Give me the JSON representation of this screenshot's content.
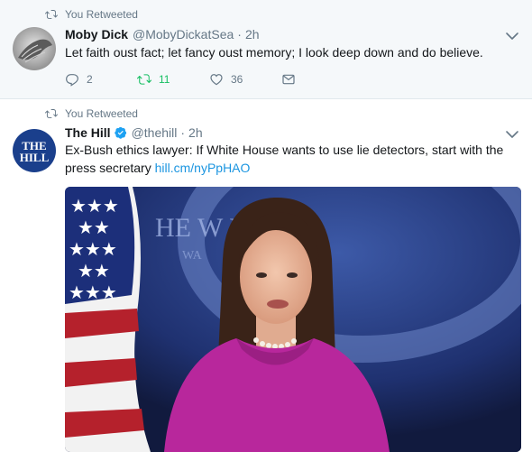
{
  "tweets": [
    {
      "retweet_label": "You Retweeted",
      "name": "Moby Dick",
      "handle": "@MobyDickatSea",
      "separator": "·",
      "time": "2h",
      "text": "Let faith oust fact; let fancy oust memory; I look deep down and do believe.",
      "replies": "2",
      "retweets": "11",
      "likes": "36"
    },
    {
      "retweet_label": "You Retweeted",
      "name": "The Hill",
      "handle": "@thehill",
      "separator": "·",
      "time": "2h",
      "verified": true,
      "text": "Ex-Bush ethics lawyer: If White House wants to use lie detectors, start with the press secretary ",
      "link": "hill.cm/nyPpHAO",
      "avatar_text": "THE HILL",
      "media_backdrop_text": "HE W   HOUSE",
      "media_backdrop_text2": "WA"
    }
  ],
  "colors": {
    "accent": "#1da1f2",
    "link": "#1b95e0",
    "retweeted": "#17bf63",
    "muted": "#657786",
    "highlight_bg": "#f5f8fa"
  },
  "icons": [
    "retweet-icon",
    "reply-icon",
    "heart-icon",
    "dm-icon",
    "chevron-down-icon",
    "verified-badge-icon"
  ]
}
